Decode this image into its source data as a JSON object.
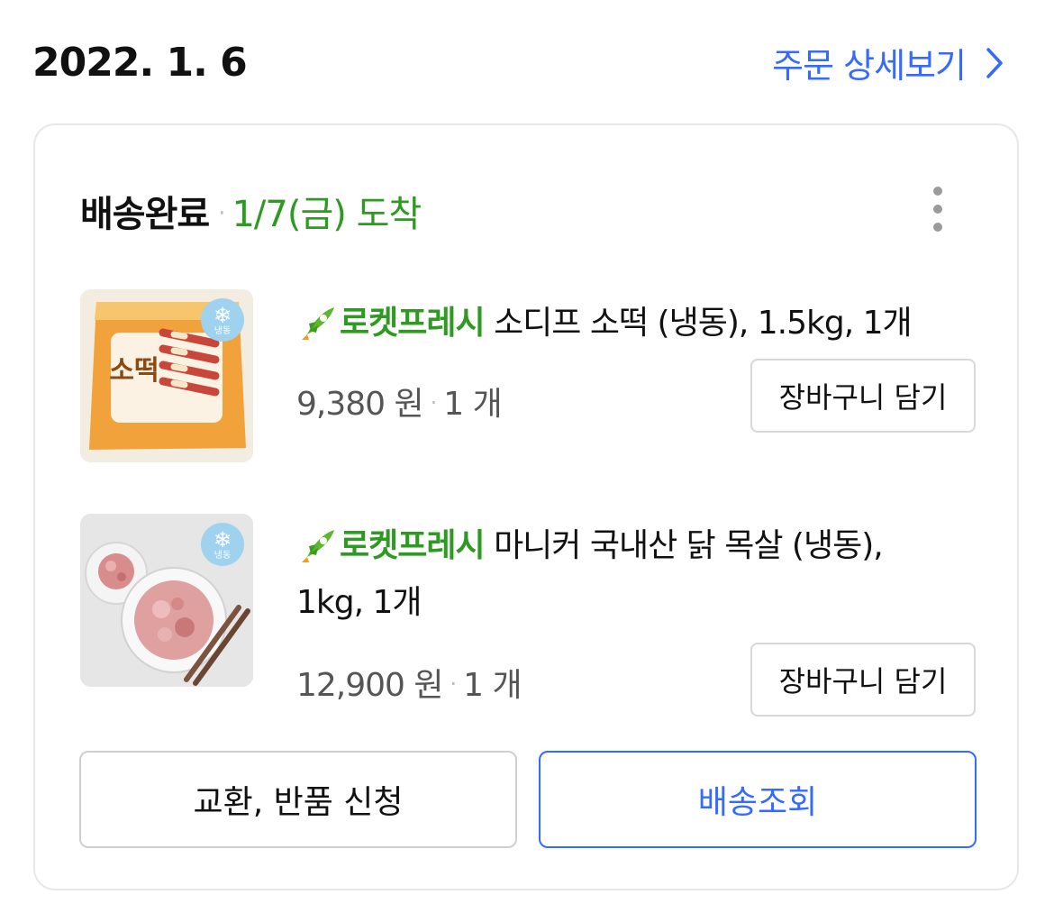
{
  "order": {
    "date": "2022. 1. 6",
    "detail_link": "주문 상세보기"
  },
  "delivery": {
    "status": "배송완료",
    "separator": "·",
    "eta": "1/7(금) 도착"
  },
  "items": [
    {
      "badge": "로켓프레시",
      "name": "소디프 소떡 (냉동), 1.5kg, 1개",
      "price": "9,380 원",
      "qty": "1 개",
      "cart_label": "장바구니 담기",
      "frozen_label": "냉동",
      "package_text": "소떡"
    },
    {
      "badge": "로켓프레시",
      "name": "마니커 국내산 닭 목살 (냉동),",
      "name_line2": "1kg, 1개",
      "price": "12,900 원",
      "qty": "1 개",
      "cart_label": "장바구니 담기",
      "frozen_label": "냉동"
    }
  ],
  "actions": {
    "exchange_return": "교환, 반품 신청",
    "track": "배송조회"
  },
  "colors": {
    "accent_blue": "#346aff",
    "rocket_green": "#2e9a22"
  }
}
